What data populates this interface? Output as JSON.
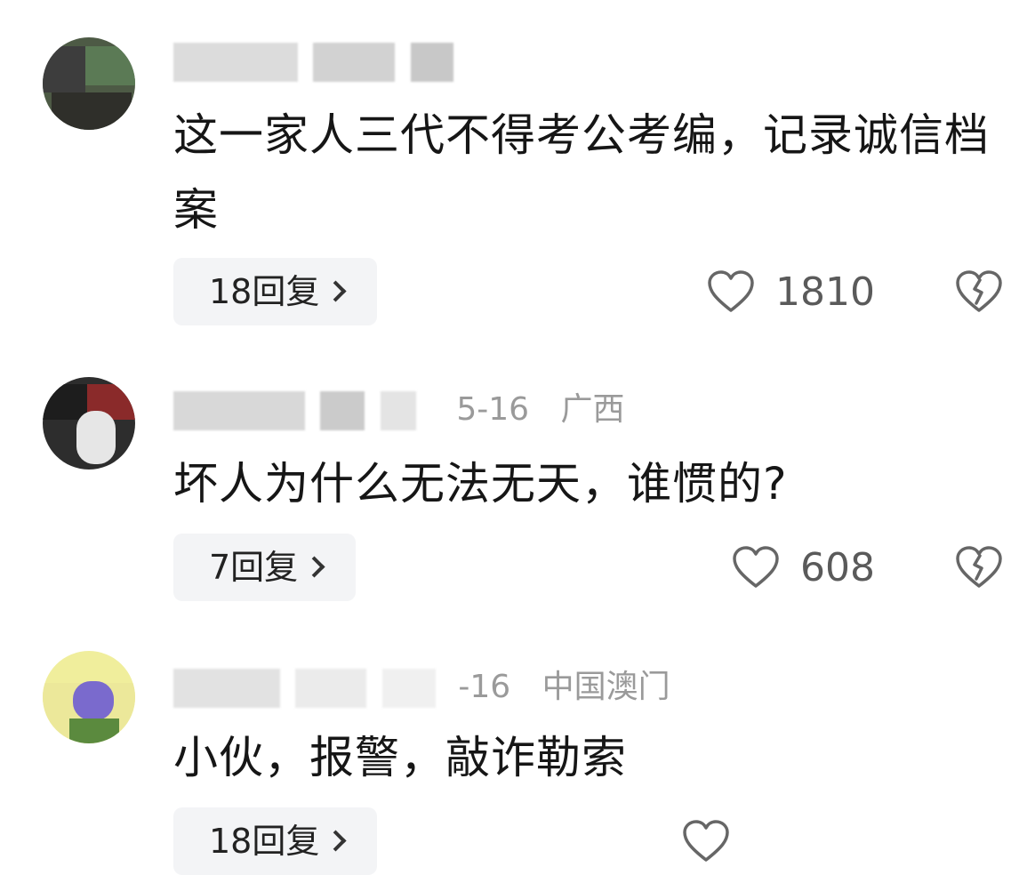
{
  "comments": [
    {
      "meta_fragment": "",
      "date": "",
      "location": "",
      "text": "这一家人三代不得考公考编，记录诚信档案",
      "reply_label": "18回复",
      "like_count": "1810",
      "colors": {
        "avatar": "#556b4f"
      }
    },
    {
      "meta_fragment": "",
      "date": "5-16",
      "location": "广西",
      "text": "坏人为什么无法无天，谁惯的?",
      "reply_label": "7回复",
      "like_count": "608",
      "colors": {
        "avatar": "#3a3a3a"
      }
    },
    {
      "meta_fragment": "",
      "date": "-16",
      "location": "中国澳门",
      "text": "小伙，报警，敲诈勒索",
      "reply_label": "18回复",
      "like_count": "",
      "colors": {
        "avatar": "#e8e6a0"
      }
    }
  ],
  "icons": {
    "like": "heart-outline-icon",
    "dislike": "broken-heart-icon",
    "reply_arrow": "chevron-right-icon"
  }
}
